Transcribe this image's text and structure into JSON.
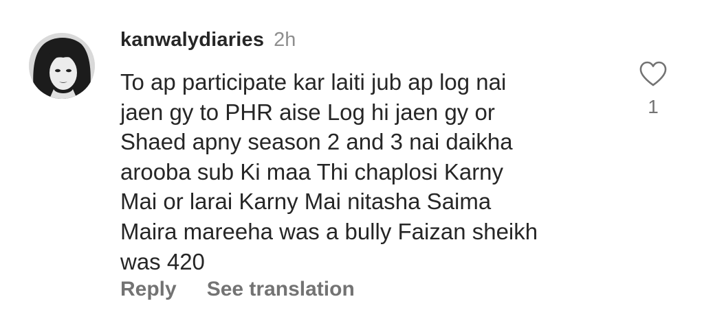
{
  "comment": {
    "username": "kanwalydiaries",
    "timestamp": "2h",
    "text_lines": [
      "To ap participate kar laiti jub ap log nai",
      "jaen gy to PHR aise Log hi jaen gy or",
      "Shaed apny season 2 and 3 nai daikha",
      "arooba sub Ki maa Thi chaplosi Karny",
      "Mai or larai Karny Mai nitasha Saima",
      "Maira mareeha was a bully Faizan sheikh",
      "was 420"
    ],
    "like_count": "1",
    "like_icon": "heart-outline-icon"
  },
  "actions": {
    "reply_label": "Reply",
    "translate_label": "See translation"
  },
  "colors": {
    "text_primary": "#262626",
    "text_secondary": "#737373",
    "timestamp": "#8e8e8e",
    "background": "#ffffff"
  }
}
